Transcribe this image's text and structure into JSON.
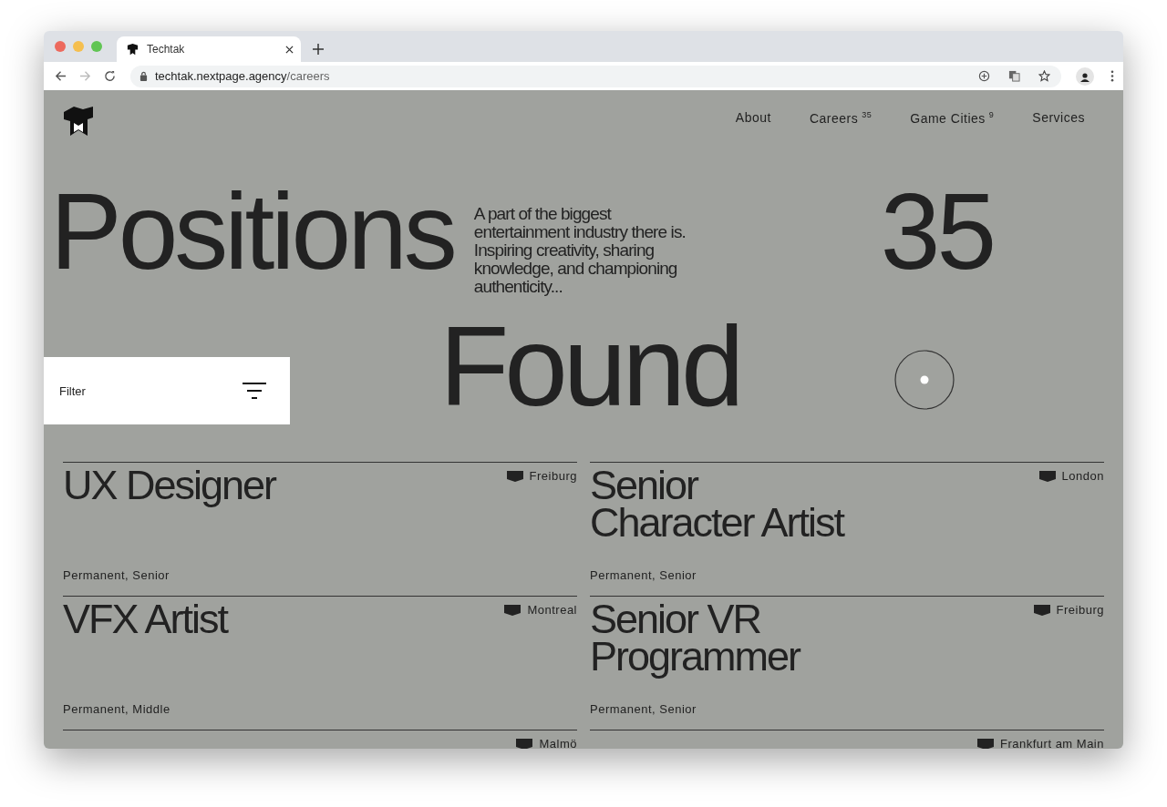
{
  "browser": {
    "tab_title": "Techtak",
    "url_domain": "techtak.nextpage.agency",
    "url_path": "/careers"
  },
  "nav": [
    {
      "label": "About"
    },
    {
      "label": "Careers",
      "count": "35"
    },
    {
      "label": "Game Cities",
      "count": "9"
    },
    {
      "label": "Services"
    }
  ],
  "hero": {
    "heading_1": "Positions",
    "description": "A part of the biggest entertainment industry there is. Inspiring creativity, sharing knowledge, and championing authenticity...",
    "count": "35",
    "heading_2": "Found"
  },
  "filter": {
    "label": "Filter"
  },
  "jobs": [
    {
      "title_lines": [
        "UX Designer"
      ],
      "location": "Freiburg",
      "tags": "Permanent, Senior"
    },
    {
      "title_lines": [
        "Senior",
        "Character Artist"
      ],
      "location": "London",
      "tags": "Permanent, Senior"
    },
    {
      "title_lines": [
        "VFX Artist"
      ],
      "location": "Montreal",
      "tags": "Permanent, Middle"
    },
    {
      "title_lines": [
        "Senior VR",
        "Programmer"
      ],
      "location": "Freiburg",
      "tags": "Permanent, Senior"
    },
    {
      "location": "Malmö"
    },
    {
      "location": "Frankfurt am Main"
    }
  ]
}
